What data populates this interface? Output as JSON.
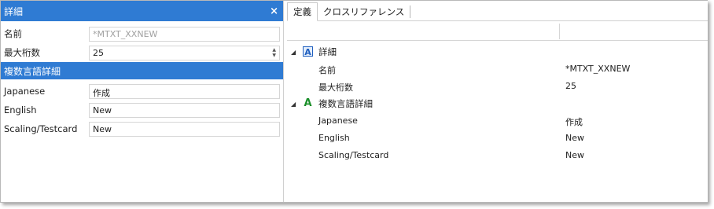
{
  "left_panel": {
    "title": "詳細",
    "close_glyph": "×",
    "fields": [
      {
        "label": "名前",
        "value": "*MTXT_XXNEW"
      },
      {
        "label": "最大桁数",
        "value": "25"
      }
    ],
    "section_title": "複数言語詳細",
    "language_fields": [
      {
        "label": "Japanese",
        "value": "作成"
      },
      {
        "label": "English",
        "value": "New"
      },
      {
        "label": "Scaling/Testcard",
        "value": "New"
      }
    ]
  },
  "right_panel": {
    "tabs": [
      {
        "label": "定義",
        "active": true
      },
      {
        "label": "クロスリファレンス",
        "active": false
      }
    ],
    "groups": [
      {
        "label": "詳細",
        "icon": "blue-a-icon",
        "icon_glyph": "A",
        "props": [
          {
            "name": "名前",
            "value": "*MTXT_XXNEW"
          },
          {
            "name": "最大桁数",
            "value": "25"
          }
        ]
      },
      {
        "label": "複数言語詳細",
        "icon": "green-a-icon",
        "icon_glyph": "A",
        "props": [
          {
            "name": "Japanese",
            "value": "作成"
          },
          {
            "name": "English",
            "value": "New"
          },
          {
            "name": "Scaling/Testcard",
            "value": "New"
          }
        ]
      }
    ],
    "toggle_glyph": "◢"
  },
  "colors": {
    "accent": "#2f7bd3"
  }
}
